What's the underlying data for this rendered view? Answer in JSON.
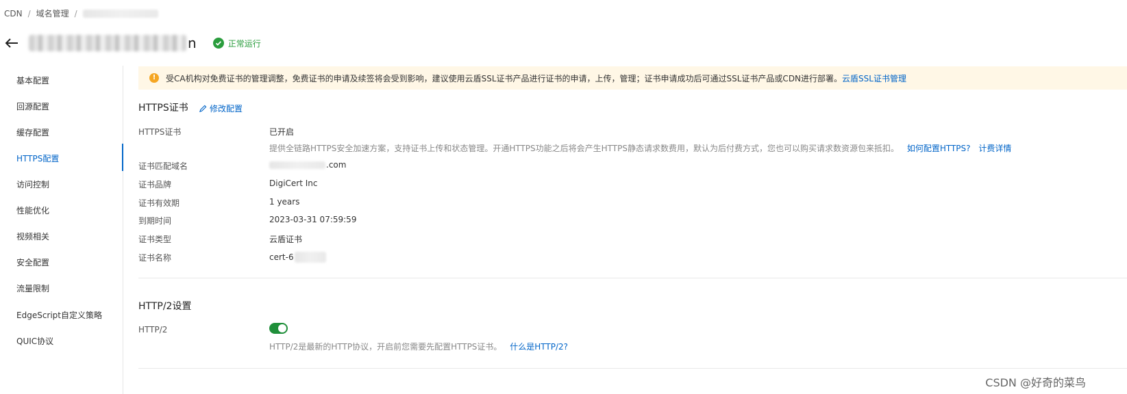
{
  "breadcrumb": {
    "root": "CDN",
    "sep": "/",
    "level2": "域名管理"
  },
  "header": {
    "domain_tail": "n",
    "status": "正常运行"
  },
  "sidebar": {
    "items": [
      {
        "label": "基本配置"
      },
      {
        "label": "回源配置"
      },
      {
        "label": "缓存配置"
      },
      {
        "label": "HTTPS配置"
      },
      {
        "label": "访问控制"
      },
      {
        "label": "性能优化"
      },
      {
        "label": "视频相关"
      },
      {
        "label": "安全配置"
      },
      {
        "label": "流量限制"
      },
      {
        "label": "EdgeScript自定义策略"
      },
      {
        "label": "QUIC协议"
      }
    ],
    "active_index": 3
  },
  "notice": {
    "text": "受CA机构对免费证书的管理调整，免费证书的申请及续签将会受到影响，建议使用云盾SSL证书产品进行证书的申请，上传，管理；证书申请成功后可通过SSL证书产品或CDN进行部署。",
    "link": "云盾SSL证书管理"
  },
  "https": {
    "title": "HTTPS证书",
    "edit": "修改配置",
    "rows": [
      {
        "label": "HTTPS证书",
        "value": "已开启"
      },
      {
        "label": "证书匹配域名",
        "value": ".com"
      },
      {
        "label": "证书品牌",
        "value": "DigiCert Inc"
      },
      {
        "label": "证书有效期",
        "value": "1 years"
      },
      {
        "label": "到期时间",
        "value": "2023-03-31 07:59:59"
      },
      {
        "label": "证书类型",
        "value": "云盾证书"
      },
      {
        "label": "证书名称",
        "value": "cert-6"
      }
    ],
    "desc": "提供全链路HTTPS安全加速方案，支持证书上传和状态管理。开通HTTPS功能之后将会产生HTTPS静态请求数费用，默认为后付费方式，您也可以购买请求数资源包来抵扣。",
    "desc_link1": "如何配置HTTPS?",
    "desc_link2": "计费详情"
  },
  "http2": {
    "title": "HTTP/2设置",
    "label": "HTTP/2",
    "enabled": true,
    "hint": "HTTP/2是最新的HTTP协议，开启前您需要先配置HTTPS证书。",
    "hint_link": "什么是HTTP/2?"
  },
  "watermark": "CSDN @好奇的菜鸟",
  "colors": {
    "accent": "#0064c8",
    "success": "#2a9d3d",
    "toggle_on": "#1f8f3a",
    "notice_bg": "#fff7e6",
    "warn": "#f5a623"
  },
  "icons": {
    "back": "arrow-left-icon",
    "status": "check-circle-icon",
    "notice": "warning-icon",
    "edit": "pencil-icon"
  }
}
